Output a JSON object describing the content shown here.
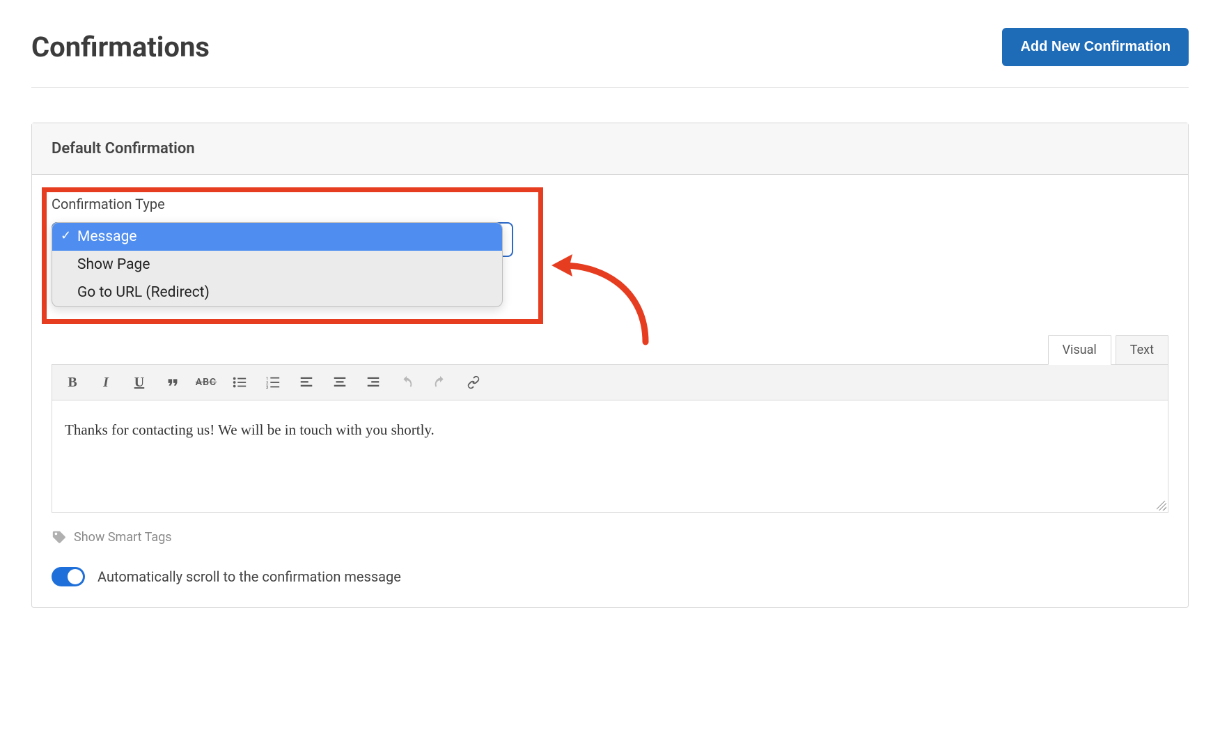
{
  "header": {
    "title": "Confirmations",
    "add_button": "Add New Confirmation"
  },
  "panel": {
    "title": "Default Confirmation"
  },
  "confirmation_type": {
    "label": "Confirmation Type",
    "options": [
      "Message",
      "Show Page",
      "Go to URL (Redirect)"
    ],
    "selected_index": 0
  },
  "editor": {
    "tabs": {
      "visual": "Visual",
      "text": "Text",
      "active": "visual"
    },
    "toolbar": {
      "bold": "B",
      "italic": "I",
      "underline": "U",
      "quote": "❝",
      "strike": "ABC"
    },
    "content": "Thanks for contacting us! We will be in touch with you shortly."
  },
  "smart_tags": {
    "label": "Show Smart Tags"
  },
  "auto_scroll": {
    "label": "Automatically scroll to the confirmation message",
    "enabled": true
  }
}
